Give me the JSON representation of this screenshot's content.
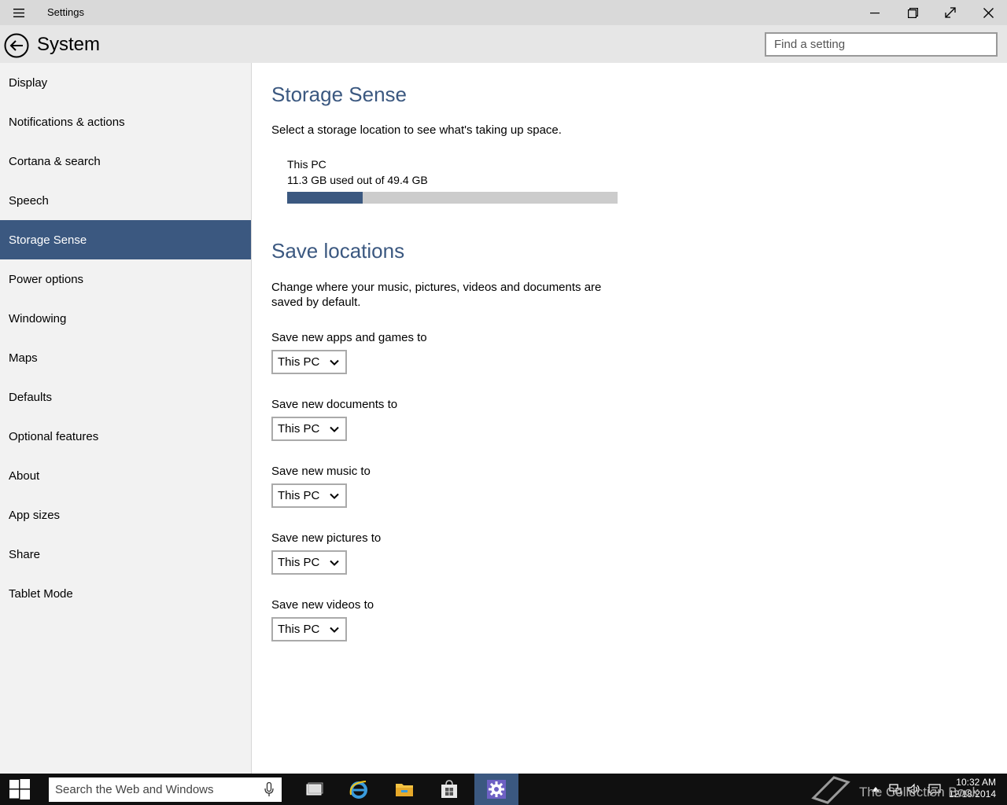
{
  "window": {
    "title": "Settings",
    "header_title": "System",
    "search_placeholder": "Find a setting"
  },
  "sidebar": {
    "items": [
      {
        "label": "Display"
      },
      {
        "label": "Notifications & actions"
      },
      {
        "label": "Cortana & search"
      },
      {
        "label": "Speech"
      },
      {
        "label": "Storage Sense",
        "selected": true
      },
      {
        "label": "Power options"
      },
      {
        "label": "Windowing"
      },
      {
        "label": "Maps"
      },
      {
        "label": "Defaults"
      },
      {
        "label": "Optional features"
      },
      {
        "label": "About"
      },
      {
        "label": "App sizes"
      },
      {
        "label": "Share"
      },
      {
        "label": "Tablet Mode"
      }
    ]
  },
  "storage": {
    "heading": "Storage Sense",
    "description": "Select a storage location to see what's taking up space.",
    "drive_name": "This PC",
    "usage_text": "11.3 GB used out of 49.4 GB",
    "used_fraction": 0.229
  },
  "save_locations": {
    "heading": "Save locations",
    "description": "Change where your music, pictures, videos and documents are saved by default.",
    "settings": [
      {
        "label": "Save new apps and games to",
        "value": "This PC"
      },
      {
        "label": "Save new documents to",
        "value": "This PC"
      },
      {
        "label": "Save new music to",
        "value": "This PC"
      },
      {
        "label": "Save new pictures to",
        "value": "This PC"
      },
      {
        "label": "Save new videos to",
        "value": "This PC"
      }
    ]
  },
  "taskbar": {
    "search_placeholder": "Search the Web and Windows",
    "time": "10:32 AM",
    "date": "12/18/2014",
    "watermark": "The Collection Book"
  },
  "colors": {
    "accent": "#3b5880",
    "titlebar": "#d9d9d9",
    "sidebar": "#f2f2f2",
    "taskbar": "#101010"
  }
}
